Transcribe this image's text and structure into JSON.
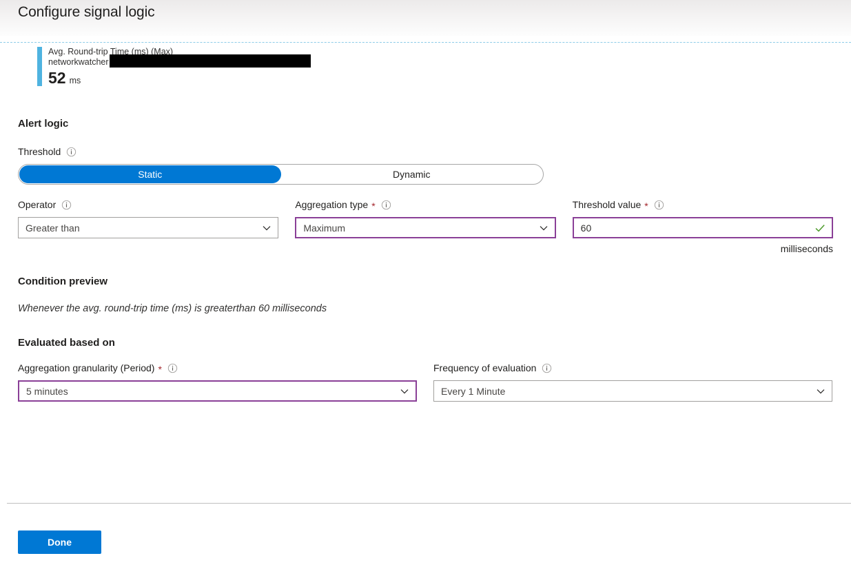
{
  "header": {
    "title": "Configure signal logic"
  },
  "chart_preview": {
    "legend": {
      "metric_name": "Avg. Round-trip Time (ms) (Max)",
      "resource_name": "networkwatcher",
      "resource_redacted": true,
      "value": "52",
      "unit": "ms",
      "series_color": "#4fb3e0"
    }
  },
  "alert_logic": {
    "section_title": "Alert logic",
    "threshold": {
      "label": "Threshold",
      "info_icon": "info-icon",
      "options": [
        {
          "label": "Static",
          "selected": true
        },
        {
          "label": "Dynamic",
          "selected": false
        }
      ],
      "selected_value": "Static"
    },
    "operator": {
      "label": "Operator",
      "info_icon": "info-icon",
      "value": "Greater than",
      "required": false,
      "modified": false,
      "chevron_icon": "chevron-down-icon"
    },
    "aggregation_type": {
      "label": "Aggregation type",
      "required_marker": "*",
      "info_icon": "info-icon",
      "value": "Maximum",
      "required": true,
      "modified": true,
      "chevron_icon": "chevron-down-icon"
    },
    "threshold_value": {
      "label": "Threshold value",
      "required_marker": "*",
      "info_icon": "info-icon",
      "value": "60",
      "unit_suffix": "milliseconds",
      "required": true,
      "modified": true,
      "validation_icon": "checkmark-icon",
      "validation_color": "#4c9a2a"
    }
  },
  "condition_preview": {
    "section_title": "Condition preview",
    "text": "Whenever the avg. round-trip time (ms) is greaterthan 60 milliseconds"
  },
  "evaluated_based_on": {
    "section_title": "Evaluated based on",
    "aggregation_granularity": {
      "label": "Aggregation granularity (Period)",
      "required_marker": "*",
      "info_icon": "info-icon",
      "value": "5 minutes",
      "required": true,
      "modified": true,
      "chevron_icon": "chevron-down-icon"
    },
    "frequency_of_evaluation": {
      "label": "Frequency of evaluation",
      "info_icon": "info-icon",
      "value": "Every 1 Minute",
      "required": false,
      "modified": false,
      "chevron_icon": "chevron-down-icon"
    }
  },
  "footer": {
    "done_label": "Done"
  },
  "colors": {
    "accent": "#0078d4",
    "modified_border": "#8a3f97",
    "required_star": "#a4262c",
    "validation_green": "#4c9a2a",
    "series_blue": "#4fb3e0",
    "divider_blue": "#8ccbe8"
  }
}
